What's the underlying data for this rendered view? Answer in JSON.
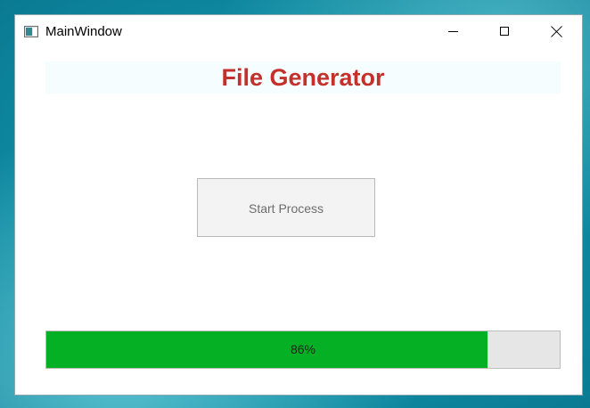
{
  "window": {
    "title": "MainWindow"
  },
  "header": {
    "title": "File Generator",
    "title_color": "#c4302b"
  },
  "actions": {
    "start_label": "Start Process"
  },
  "progress": {
    "value_percent": 86,
    "label": "86%",
    "fill_color": "#06b025"
  },
  "icons": {
    "app": "app-window-icon",
    "minimize": "minimize-icon",
    "maximize": "maximize-icon",
    "close": "close-icon"
  }
}
